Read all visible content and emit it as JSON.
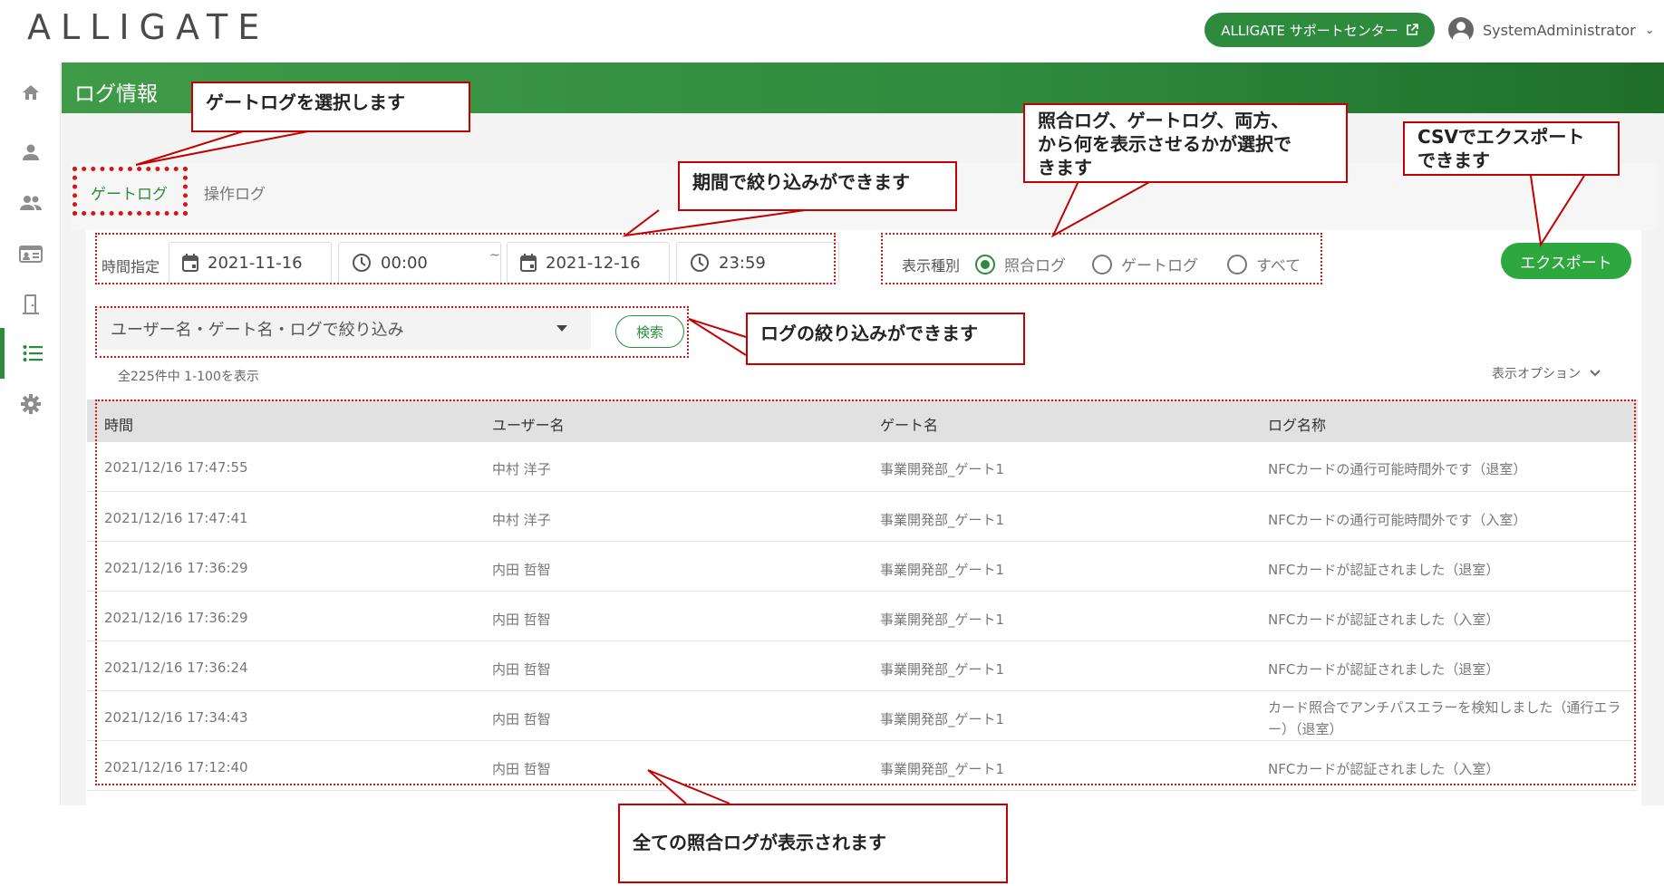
{
  "topbar": {
    "logo": "ALLIGATE",
    "support_label": "ALLIGATE サポートセンター",
    "support_icon": "external-link-icon",
    "user_name": "SystemAdministrator"
  },
  "sidebar": {
    "items": [
      {
        "icon": "home-icon"
      },
      {
        "icon": "user-icon"
      },
      {
        "icon": "users-icon"
      },
      {
        "icon": "id-card-icon"
      },
      {
        "icon": "door-icon"
      },
      {
        "icon": "list-icon",
        "active": true
      },
      {
        "icon": "gear-icon"
      }
    ]
  },
  "header": {
    "title": "ログ情報"
  },
  "tabs": [
    {
      "label": "ゲートログ",
      "active": true
    },
    {
      "label": "操作ログ",
      "active": false
    }
  ],
  "filter": {
    "time_label": "時間指定",
    "start_date": "2021-11-16",
    "start_time": "00:00",
    "separator": "~",
    "end_date": "2021-12-16",
    "end_time": "23:59",
    "kind_label": "表示種別",
    "kinds": [
      {
        "label": "照合ログ",
        "selected": true
      },
      {
        "label": "ゲートログ",
        "selected": false
      },
      {
        "label": "すべて",
        "selected": false
      }
    ],
    "export_label": "エクスポート",
    "search_placeholder": "ユーザー名・ゲート名・ログで絞り込み",
    "search_button": "検索",
    "count_text": "全225件中 1-100を表示",
    "options_label": "表示オプション"
  },
  "table": {
    "columns": [
      "時間",
      "ユーザー名",
      "ゲート名",
      "ログ名称"
    ],
    "rows": [
      [
        "2021/12/16 17:47:55",
        "中村 洋子",
        "事業開発部_ゲート1",
        "NFCカードの通行可能時間外です（退室）"
      ],
      [
        "2021/12/16 17:47:41",
        "中村 洋子",
        "事業開発部_ゲート1",
        "NFCカードの通行可能時間外です（入室）"
      ],
      [
        "2021/12/16 17:36:29",
        "内田 哲智",
        "事業開発部_ゲート1",
        "NFCカードが認証されました（退室）"
      ],
      [
        "2021/12/16 17:36:29",
        "内田 哲智",
        "事業開発部_ゲート1",
        "NFCカードが認証されました（入室）"
      ],
      [
        "2021/12/16 17:36:24",
        "内田 哲智",
        "事業開発部_ゲート1",
        "NFCカードが認証されました（退室）"
      ],
      [
        "2021/12/16 17:34:43",
        "内田 哲智",
        "事業開発部_ゲート1",
        "カード照合でアンチパスエラーを検知しました（通行エラー）（退室）"
      ],
      [
        "2021/12/16 17:12:40",
        "内田 哲智",
        "事業開発部_ゲート1",
        "NFCカードが認証されました（入室）"
      ]
    ]
  },
  "annotations": {
    "select_gate_log": "ゲートログを選択します",
    "period_filter": "期間で絞り込みができます",
    "kind_select": [
      "照合ログ、ゲートログ、両方、",
      "から何を表示させるかが選択で",
      "きます"
    ],
    "csv_export": [
      "CSVでエクスポート",
      "できます"
    ],
    "log_filter": "ログの絞り込みができます",
    "all_logs": "全ての照合ログが表示されます",
    "color": "#c40000"
  },
  "colors": {
    "brand_green": "#2e8b3e",
    "export_green": "#2ea83e",
    "annotation_red": "#d81414"
  }
}
